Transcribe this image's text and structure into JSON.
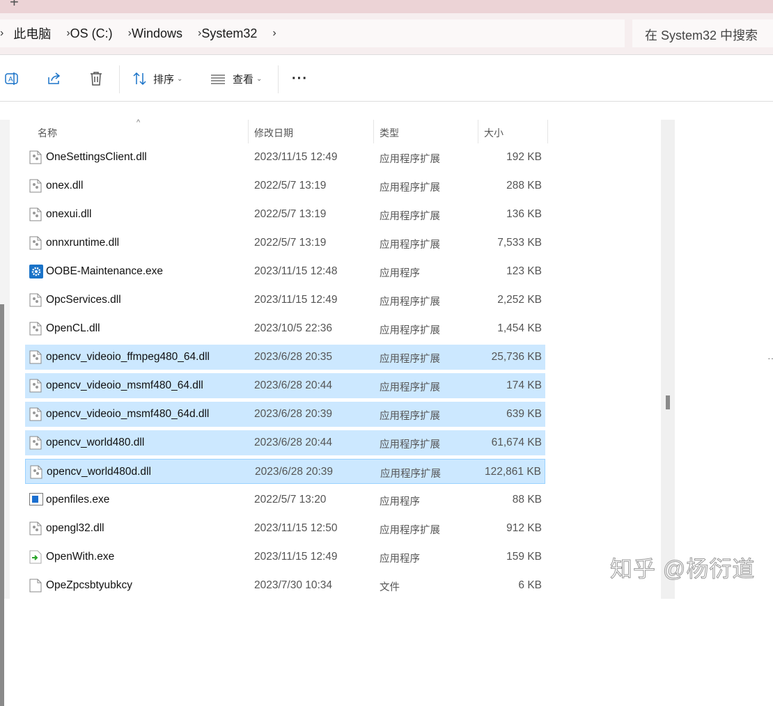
{
  "breadcrumb": [
    "此电脑",
    "OS (C:)",
    "Windows",
    "System32"
  ],
  "search": {
    "placeholder": "在 System32 中搜索"
  },
  "toolbar": {
    "sort": "排序",
    "view": "查看",
    "more": "···"
  },
  "columns": {
    "name": "名称",
    "date": "修改日期",
    "type": "类型",
    "size": "大小"
  },
  "files": [
    {
      "name": "OneSettingsClient.dll",
      "date": "2023/11/15 12:49",
      "type": "应用程序扩展",
      "size": "192 KB",
      "icon": "dll"
    },
    {
      "name": "onex.dll",
      "date": "2022/5/7 13:19",
      "type": "应用程序扩展",
      "size": "288 KB",
      "icon": "dll"
    },
    {
      "name": "onexui.dll",
      "date": "2022/5/7 13:19",
      "type": "应用程序扩展",
      "size": "136 KB",
      "icon": "dll"
    },
    {
      "name": "onnxruntime.dll",
      "date": "2022/5/7 13:19",
      "type": "应用程序扩展",
      "size": "7,533 KB",
      "icon": "dll"
    },
    {
      "name": "OOBE-Maintenance.exe",
      "date": "2023/11/15 12:48",
      "type": "应用程序",
      "size": "123 KB",
      "icon": "gear"
    },
    {
      "name": "OpcServices.dll",
      "date": "2023/11/15 12:49",
      "type": "应用程序扩展",
      "size": "2,252 KB",
      "icon": "dll"
    },
    {
      "name": "OpenCL.dll",
      "date": "2023/10/5 22:36",
      "type": "应用程序扩展",
      "size": "1,454 KB",
      "icon": "dll"
    },
    {
      "name": "opencv_videoio_ffmpeg480_64.dll",
      "date": "2023/6/28 20:35",
      "type": "应用程序扩展",
      "size": "25,736 KB",
      "icon": "dll",
      "selected": true
    },
    {
      "name": "opencv_videoio_msmf480_64.dll",
      "date": "2023/6/28 20:44",
      "type": "应用程序扩展",
      "size": "174 KB",
      "icon": "dll",
      "selected": true
    },
    {
      "name": "opencv_videoio_msmf480_64d.dll",
      "date": "2023/6/28 20:39",
      "type": "应用程序扩展",
      "size": "639 KB",
      "icon": "dll",
      "selected": true
    },
    {
      "name": "opencv_world480.dll",
      "date": "2023/6/28 20:44",
      "type": "应用程序扩展",
      "size": "61,674 KB",
      "icon": "dll",
      "selected": true
    },
    {
      "name": "opencv_world480d.dll",
      "date": "2023/6/28 20:39",
      "type": "应用程序扩展",
      "size": "122,861 KB",
      "icon": "dll",
      "selected": true,
      "focused": true
    },
    {
      "name": "openfiles.exe",
      "date": "2022/5/7 13:20",
      "type": "应用程序",
      "size": "88 KB",
      "icon": "window"
    },
    {
      "name": "opengl32.dll",
      "date": "2023/11/15 12:50",
      "type": "应用程序扩展",
      "size": "912 KB",
      "icon": "dll"
    },
    {
      "name": "OpenWith.exe",
      "date": "2023/11/15 12:49",
      "type": "应用程序",
      "size": "159 KB",
      "icon": "openwith"
    },
    {
      "name": "OpeZpcsbtyubkcy",
      "date": "2023/7/30 10:34",
      "type": "文件",
      "size": "6 KB",
      "icon": "file"
    }
  ],
  "watermark": "知乎 @杨衍道",
  "colors": {
    "selected": "#cce8ff",
    "focus_border": "#99d1ff",
    "accent": "#1a73c8"
  }
}
